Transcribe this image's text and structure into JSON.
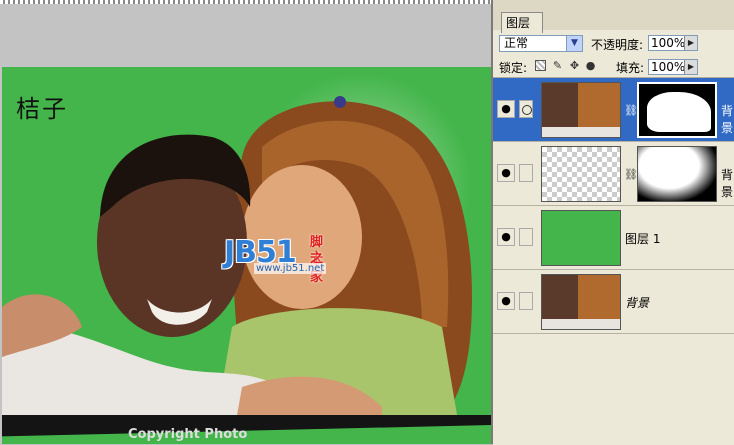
{
  "document": {
    "corner_text": "桔子",
    "copyright_text": "Copyright Photo"
  },
  "watermark": {
    "logo": "JB51",
    "cn_line1": "脚本",
    "cn_line2": "之家",
    "url": "www.jb51.net"
  },
  "layers_panel": {
    "tab_label": "图层",
    "blend_mode": "正常",
    "opacity_label": "不透明度:",
    "opacity_value": "100%",
    "lock_label": "锁定:",
    "fill_label": "填充:",
    "fill_value": "100%",
    "layers": [
      {
        "name": "背景",
        "selected": true,
        "visible": true
      },
      {
        "name": "背景",
        "selected": false,
        "visible": true
      },
      {
        "name": "图层 1",
        "selected": false,
        "visible": true
      },
      {
        "name": "背景",
        "selected": false,
        "visible": true
      }
    ]
  },
  "colors": {
    "green_fill": "#43b54a",
    "selection_blue": "#316ac5",
    "panel_bg": "#ece9d8"
  }
}
